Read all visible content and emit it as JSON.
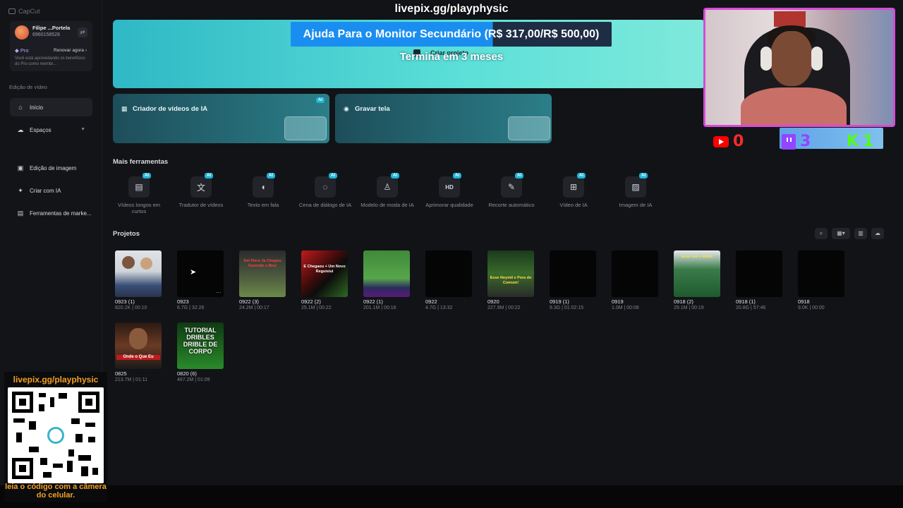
{
  "app": {
    "brand": "CapCut"
  },
  "account": {
    "name": "Filipe ...Portela",
    "id": "6960158528",
    "plan": "Pro",
    "renew_label": "Renovar agora",
    "description": "Você está aproveitando os benefícios do Pro como membr..."
  },
  "sidebar": {
    "section_label": "Edição de vídeo",
    "items": [
      {
        "label": "Início",
        "icon": "home-icon"
      },
      {
        "label": "Espaços",
        "icon": "cloud-icon"
      },
      {
        "label": "Edição de imagem",
        "icon": "image-icon"
      },
      {
        "label": "Criar com IA",
        "icon": "sparkle-icon"
      },
      {
        "label": "Ferramentas de marke...",
        "icon": "briefcase-icon"
      }
    ]
  },
  "hero": {
    "create_label": "Criar projeto"
  },
  "cards": [
    {
      "label": "Criador de vídeos de IA",
      "badge": "AI"
    },
    {
      "label": "Gravar tela",
      "badge": ""
    }
  ],
  "tools": {
    "title": "Mais ferramentas",
    "badge": "AI",
    "items": [
      {
        "label": "Vídeos longos em curtos",
        "icon": "film-icon"
      },
      {
        "label": "Tradutor de vídeos",
        "icon": "translate-icon"
      },
      {
        "label": "Texto em fala",
        "icon": "speech-icon"
      },
      {
        "label": "Cena de diálogo de IA",
        "icon": "dialog-icon"
      },
      {
        "label": "Modelo de moda de IA",
        "icon": "shirt-icon"
      },
      {
        "label": "Aprimorar qualidade",
        "icon": "hd-icon"
      },
      {
        "label": "Recorte automático",
        "icon": "eraser-icon"
      },
      {
        "label": "Vídeo de IA",
        "icon": "video-plus-icon"
      },
      {
        "label": "Imagem de IA",
        "icon": "image-plus-icon"
      }
    ]
  },
  "projects": {
    "title": "Projetos",
    "items": [
      {
        "name": "0923 (1)",
        "meta": "820.2K | 00:10",
        "thumb": "people"
      },
      {
        "name": "0923",
        "meta": "6.7G | 32:26",
        "thumb": "dark"
      },
      {
        "name": "0922 (3)",
        "meta": "24.2M | 00:17",
        "thumb": "Dei Fiero Ja Chegou Fazendo o Brui"
      },
      {
        "name": "0922 (2)",
        "meta": "25.1M | 00:22",
        "thumb": "E Chegaou + Um Novo Reguisiui"
      },
      {
        "name": "0922 (1)",
        "meta": "201.1M | 00:16",
        "thumb": "green"
      },
      {
        "name": "0922",
        "meta": "4.7G | 13:32",
        "thumb": "dark"
      },
      {
        "name": "0920",
        "meta": "227.9M | 00:22",
        "thumb": "Esse Neymil e Pera do Comum!"
      },
      {
        "name": "0919 (1)",
        "meta": "9.3G | 01:02:15",
        "thumb": "dark"
      },
      {
        "name": "0919",
        "meta": "1.0M | 00:08",
        "thumb": "dark"
      },
      {
        "name": "0918 (2)",
        "meta": "29.1M | 00:19",
        "thumb": "Esse Gol e Muito"
      },
      {
        "name": "0918 (1)",
        "meta": "20.8G | 57:46",
        "thumb": "dark"
      },
      {
        "name": "0918",
        "meta": "9.0K | 00:00",
        "thumb": "dark"
      },
      {
        "name": "0825",
        "meta": "213.7M | 01:11",
        "thumb": "Onde o Que Eu"
      },
      {
        "name": "0820 (6)",
        "meta": "467.2M | 01:09",
        "thumb": "TUTORIAL DRIBLES DRIBLE DE CORPO"
      }
    ]
  },
  "overlay": {
    "url": "livepix.gg/playphysic",
    "goal_text": "Ajuda Para o Monitor Secundário (R$ 317,00/R$ 500,00)",
    "goal_progress": 0.634,
    "subtitle": "Termina em 3 meses",
    "youtube_count": "0",
    "twitch_count": "3",
    "kick_count": "1",
    "qr_url": "livepix.gg/playphysic",
    "qr_hint": "leia o código com a câmera do celular."
  },
  "colors": {
    "accent_cyan": "#1eb4d8",
    "hero_gradient_start": "#2fb8c5",
    "goal_blue": "#1a8ef0",
    "qr_orange": "#f5a023",
    "webcam_border": "#d84ad8",
    "kick_green": "#53fc18",
    "twitch_purple": "#9146ff",
    "youtube_red": "#ff0000"
  }
}
